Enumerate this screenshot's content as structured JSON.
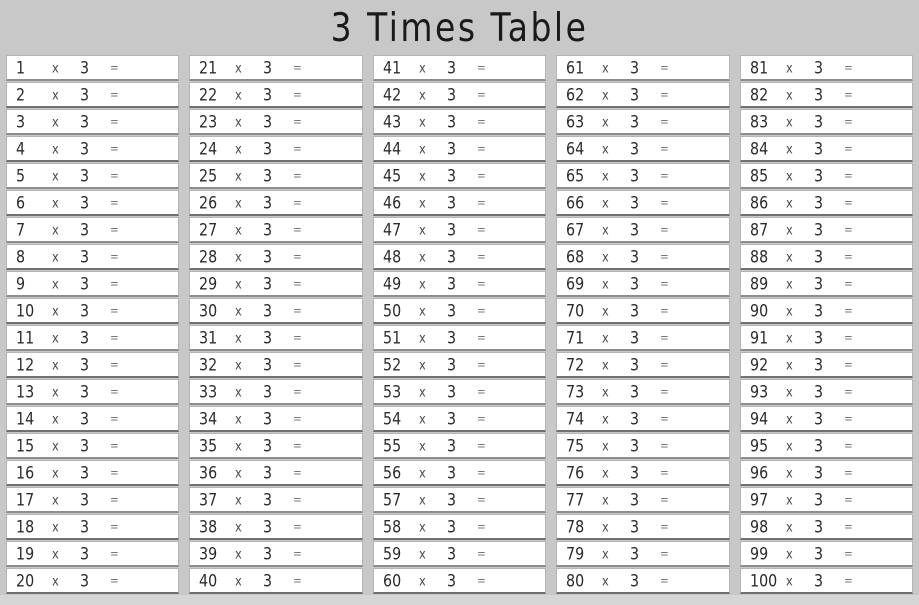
{
  "worksheet": {
    "title": "3 Times Table",
    "multiplier": "3",
    "times_symbol": "x",
    "equals_symbol": "=",
    "answer_value": "",
    "background_color": "#c8c8c8",
    "cell_background_color": "#ffffff",
    "cell_border_color": "#b5b5b5",
    "text_color": "#2b2b2b",
    "rows_per_column": 20,
    "column_count": 5,
    "columns": [
      {
        "name": "column-1",
        "rows": [
          {
            "multiplicand": "1"
          },
          {
            "multiplicand": "2"
          },
          {
            "multiplicand": "3"
          },
          {
            "multiplicand": "4"
          },
          {
            "multiplicand": "5"
          },
          {
            "multiplicand": "6"
          },
          {
            "multiplicand": "7"
          },
          {
            "multiplicand": "8"
          },
          {
            "multiplicand": "9"
          },
          {
            "multiplicand": "10"
          },
          {
            "multiplicand": "11"
          },
          {
            "multiplicand": "12"
          },
          {
            "multiplicand": "13"
          },
          {
            "multiplicand": "14"
          },
          {
            "multiplicand": "15"
          },
          {
            "multiplicand": "16"
          },
          {
            "multiplicand": "17"
          },
          {
            "multiplicand": "18"
          },
          {
            "multiplicand": "19"
          },
          {
            "multiplicand": "20"
          }
        ]
      },
      {
        "name": "column-2",
        "rows": [
          {
            "multiplicand": "21"
          },
          {
            "multiplicand": "22"
          },
          {
            "multiplicand": "23"
          },
          {
            "multiplicand": "24"
          },
          {
            "multiplicand": "25"
          },
          {
            "multiplicand": "26"
          },
          {
            "multiplicand": "27"
          },
          {
            "multiplicand": "28"
          },
          {
            "multiplicand": "29"
          },
          {
            "multiplicand": "30"
          },
          {
            "multiplicand": "31"
          },
          {
            "multiplicand": "32"
          },
          {
            "multiplicand": "33"
          },
          {
            "multiplicand": "34"
          },
          {
            "multiplicand": "35"
          },
          {
            "multiplicand": "36"
          },
          {
            "multiplicand": "37"
          },
          {
            "multiplicand": "38"
          },
          {
            "multiplicand": "39"
          },
          {
            "multiplicand": "40"
          }
        ]
      },
      {
        "name": "column-3",
        "rows": [
          {
            "multiplicand": "41"
          },
          {
            "multiplicand": "42"
          },
          {
            "multiplicand": "43"
          },
          {
            "multiplicand": "44"
          },
          {
            "multiplicand": "45"
          },
          {
            "multiplicand": "46"
          },
          {
            "multiplicand": "47"
          },
          {
            "multiplicand": "48"
          },
          {
            "multiplicand": "49"
          },
          {
            "multiplicand": "50"
          },
          {
            "multiplicand": "51"
          },
          {
            "multiplicand": "52"
          },
          {
            "multiplicand": "53"
          },
          {
            "multiplicand": "54"
          },
          {
            "multiplicand": "55"
          },
          {
            "multiplicand": "56"
          },
          {
            "multiplicand": "57"
          },
          {
            "multiplicand": "58"
          },
          {
            "multiplicand": "59"
          },
          {
            "multiplicand": "60"
          }
        ]
      },
      {
        "name": "column-4",
        "rows": [
          {
            "multiplicand": "61"
          },
          {
            "multiplicand": "62"
          },
          {
            "multiplicand": "63"
          },
          {
            "multiplicand": "64"
          },
          {
            "multiplicand": "65"
          },
          {
            "multiplicand": "66"
          },
          {
            "multiplicand": "67"
          },
          {
            "multiplicand": "68"
          },
          {
            "multiplicand": "69"
          },
          {
            "multiplicand": "70"
          },
          {
            "multiplicand": "71"
          },
          {
            "multiplicand": "72"
          },
          {
            "multiplicand": "73"
          },
          {
            "multiplicand": "74"
          },
          {
            "multiplicand": "75"
          },
          {
            "multiplicand": "76"
          },
          {
            "multiplicand": "77"
          },
          {
            "multiplicand": "78"
          },
          {
            "multiplicand": "79"
          },
          {
            "multiplicand": "80"
          }
        ]
      },
      {
        "name": "column-5",
        "rows": [
          {
            "multiplicand": "81"
          },
          {
            "multiplicand": "82"
          },
          {
            "multiplicand": "83"
          },
          {
            "multiplicand": "84"
          },
          {
            "multiplicand": "85"
          },
          {
            "multiplicand": "86"
          },
          {
            "multiplicand": "87"
          },
          {
            "multiplicand": "88"
          },
          {
            "multiplicand": "89"
          },
          {
            "multiplicand": "90"
          },
          {
            "multiplicand": "91"
          },
          {
            "multiplicand": "92"
          },
          {
            "multiplicand": "93"
          },
          {
            "multiplicand": "94"
          },
          {
            "multiplicand": "95"
          },
          {
            "multiplicand": "96"
          },
          {
            "multiplicand": "97"
          },
          {
            "multiplicand": "98"
          },
          {
            "multiplicand": "99"
          },
          {
            "multiplicand": "100"
          }
        ]
      }
    ]
  }
}
